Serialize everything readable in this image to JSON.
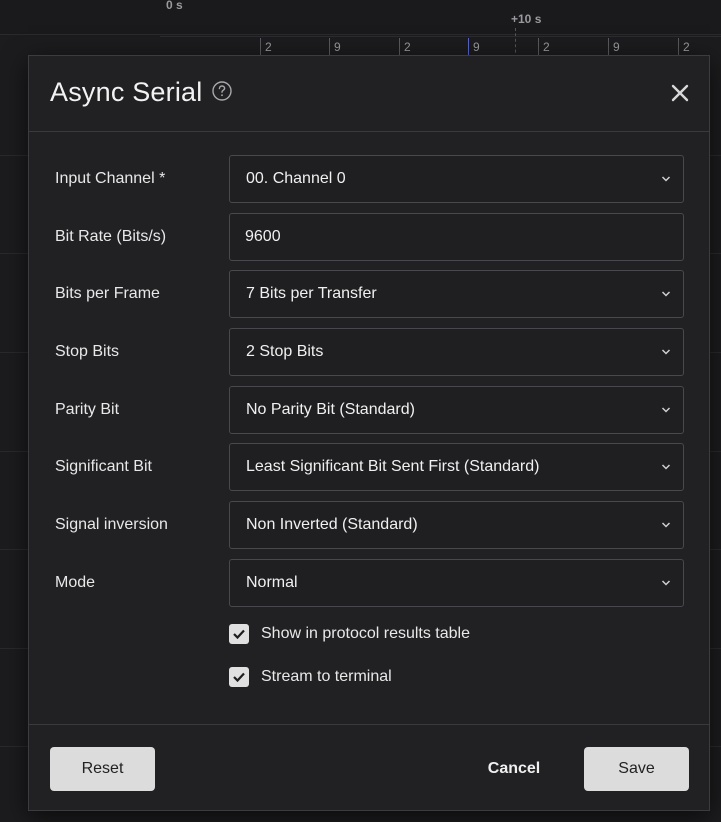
{
  "timeline": {
    "mark_start": "0 s",
    "mark_plus10": "+10 s",
    "ticks": [
      "2",
      "9",
      "2",
      "9",
      "2",
      "9",
      "2"
    ]
  },
  "dialog": {
    "title": "Async Serial",
    "help_icon": "question-circle-icon",
    "close_icon": "close-icon",
    "fields": {
      "input_channel": {
        "label": "Input Channel *",
        "value": "00.  Channel 0"
      },
      "bit_rate": {
        "label": "Bit Rate (Bits/s)",
        "value": "9600"
      },
      "bits_per_frame": {
        "label": "Bits per Frame",
        "value": "7 Bits per Transfer"
      },
      "stop_bits": {
        "label": "Stop Bits",
        "value": "2 Stop Bits"
      },
      "parity_bit": {
        "label": "Parity Bit",
        "value": "No Parity Bit (Standard)"
      },
      "significant_bit": {
        "label": "Significant Bit",
        "value": "Least Significant Bit Sent First (Standard)"
      },
      "signal_inversion": {
        "label": "Signal inversion",
        "value": "Non Inverted (Standard)"
      },
      "mode": {
        "label": "Mode",
        "value": "Normal"
      }
    },
    "checkboxes": {
      "show_in_table": {
        "label": "Show in protocol results table",
        "checked": true
      },
      "stream_to_terminal": {
        "label": "Stream to terminal",
        "checked": true
      }
    },
    "buttons": {
      "reset": "Reset",
      "cancel": "Cancel",
      "save": "Save"
    }
  }
}
